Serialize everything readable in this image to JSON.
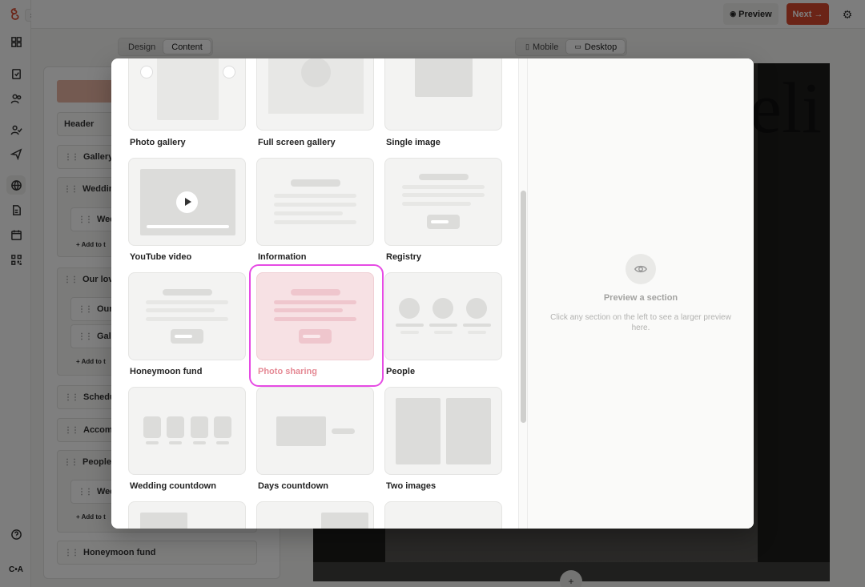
{
  "app": {
    "brand_logo": "swirl-logo",
    "user_initials": "C•A"
  },
  "topbar": {
    "preview_label": "Preview",
    "next_label": "Next →"
  },
  "editor": {
    "tabs": [
      "Design",
      "Content"
    ],
    "active_tab": "Content"
  },
  "device": {
    "options": [
      "Mobile",
      "Desktop"
    ],
    "active": "Desktop"
  },
  "sections_panel": {
    "rows": [
      {
        "label": "Header"
      },
      {
        "label": "Gallery"
      },
      {
        "label": "Wedding d"
      },
      {
        "label": "Weddi",
        "sub": true
      },
      {
        "label": "Our love s"
      },
      {
        "label": "Our Lo",
        "sub": true
      },
      {
        "label": "Galler",
        "sub": true
      },
      {
        "label": "Schedule"
      },
      {
        "label": "Accommo"
      },
      {
        "label": "People"
      },
      {
        "label": "Weddi",
        "sub": true
      },
      {
        "label": "Honeymoon fund"
      }
    ],
    "add_label": "Add to t"
  },
  "preview_canvas": {
    "script_text": "eli"
  },
  "modal": {
    "cards": [
      {
        "label": "Photo gallery",
        "kind": "gallery"
      },
      {
        "label": "Full screen gallery",
        "kind": "fullscreen"
      },
      {
        "label": "Single image",
        "kind": "single"
      },
      {
        "label": "YouTube video",
        "kind": "video"
      },
      {
        "label": "Information",
        "kind": "info"
      },
      {
        "label": "Registry",
        "kind": "registry"
      },
      {
        "label": "Honeymoon fund",
        "kind": "fund"
      },
      {
        "label": "Photo sharing",
        "kind": "sharing",
        "selected": true
      },
      {
        "label": "People",
        "kind": "people"
      },
      {
        "label": "Wedding countdown",
        "kind": "countdown"
      },
      {
        "label": "Days countdown",
        "kind": "days"
      },
      {
        "label": "Two images",
        "kind": "two"
      }
    ],
    "preview": {
      "title": "Preview a section",
      "description": "Click any section on the left to see a larger preview here."
    }
  },
  "colors": {
    "accent": "#d6492f",
    "selection_ring": "#e64be4",
    "selected_fill": "#f7e1e4"
  }
}
